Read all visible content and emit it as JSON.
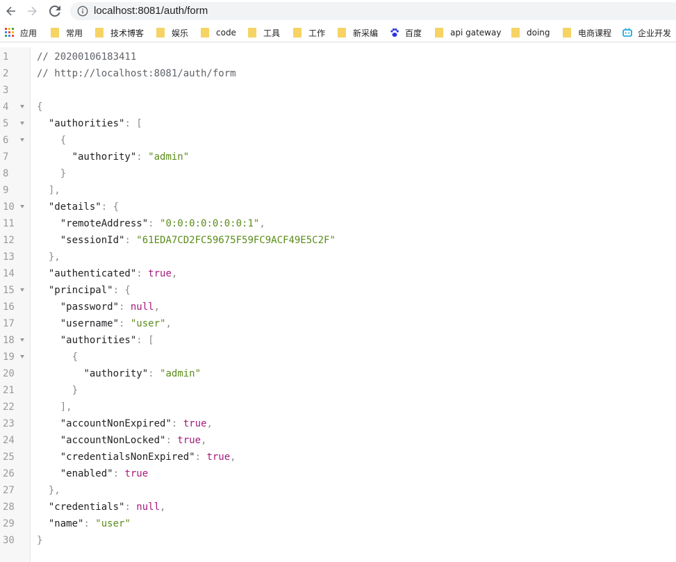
{
  "browser": {
    "url": "localhost:8081/auth/form"
  },
  "bookmarks": [
    {
      "label": "应用",
      "icon": "apps-grid-icon"
    },
    {
      "label": "常用",
      "icon": "folder-icon"
    },
    {
      "label": "技术博客",
      "icon": "folder-icon"
    },
    {
      "label": "娱乐",
      "icon": "folder-icon"
    },
    {
      "label": "code",
      "icon": "folder-icon"
    },
    {
      "label": "工具",
      "icon": "folder-icon"
    },
    {
      "label": "工作",
      "icon": "folder-icon"
    },
    {
      "label": "新采编",
      "icon": "folder-icon"
    },
    {
      "label": "百度",
      "icon": "baidu-paw-icon"
    },
    {
      "label": "api gateway",
      "icon": "folder-icon"
    },
    {
      "label": "doing",
      "icon": "folder-icon"
    },
    {
      "label": "电商课程",
      "icon": "folder-icon"
    },
    {
      "label": "企业开发",
      "icon": "bilibili-tv-icon"
    }
  ],
  "colors": {
    "string": "#5a8b19",
    "keyword": "#a5197c",
    "comment": "#5f6368",
    "folder": "#f6d365"
  },
  "lines": [
    {
      "n": "1",
      "fold": false,
      "tokens": [
        [
          "c",
          "// 20200106183411"
        ]
      ]
    },
    {
      "n": "2",
      "fold": false,
      "tokens": [
        [
          "c",
          "// http://localhost:8081/auth/form"
        ]
      ]
    },
    {
      "n": "3",
      "fold": false,
      "tokens": []
    },
    {
      "n": "4",
      "fold": true,
      "tokens": [
        [
          "p",
          "{"
        ]
      ]
    },
    {
      "n": "5",
      "fold": true,
      "tokens": [
        [
          "t",
          "  "
        ],
        [
          "k",
          "\"authorities\""
        ],
        [
          "p",
          ": ["
        ]
      ]
    },
    {
      "n": "6",
      "fold": true,
      "tokens": [
        [
          "t",
          "    "
        ],
        [
          "p",
          "{"
        ]
      ]
    },
    {
      "n": "7",
      "fold": false,
      "tokens": [
        [
          "t",
          "      "
        ],
        [
          "k",
          "\"authority\""
        ],
        [
          "p",
          ": "
        ],
        [
          "s",
          "\"admin\""
        ]
      ]
    },
    {
      "n": "8",
      "fold": false,
      "tokens": [
        [
          "t",
          "    "
        ],
        [
          "p",
          "}"
        ]
      ]
    },
    {
      "n": "9",
      "fold": false,
      "tokens": [
        [
          "t",
          "  "
        ],
        [
          "p",
          "],"
        ]
      ]
    },
    {
      "n": "10",
      "fold": true,
      "tokens": [
        [
          "t",
          "  "
        ],
        [
          "k",
          "\"details\""
        ],
        [
          "p",
          ": {"
        ]
      ]
    },
    {
      "n": "11",
      "fold": false,
      "tokens": [
        [
          "t",
          "    "
        ],
        [
          "k",
          "\"remoteAddress\""
        ],
        [
          "p",
          ": "
        ],
        [
          "s",
          "\"0:0:0:0:0:0:0:1\""
        ],
        [
          "p",
          ","
        ]
      ]
    },
    {
      "n": "12",
      "fold": false,
      "tokens": [
        [
          "t",
          "    "
        ],
        [
          "k",
          "\"sessionId\""
        ],
        [
          "p",
          ": "
        ],
        [
          "s",
          "\"61EDA7CD2FC59675F59FC9ACF49E5C2F\""
        ]
      ]
    },
    {
      "n": "13",
      "fold": false,
      "tokens": [
        [
          "t",
          "  "
        ],
        [
          "p",
          "},"
        ]
      ]
    },
    {
      "n": "14",
      "fold": false,
      "tokens": [
        [
          "t",
          "  "
        ],
        [
          "k",
          "\"authenticated\""
        ],
        [
          "p",
          ": "
        ],
        [
          "b",
          "true"
        ],
        [
          "p",
          ","
        ]
      ]
    },
    {
      "n": "15",
      "fold": true,
      "tokens": [
        [
          "t",
          "  "
        ],
        [
          "k",
          "\"principal\""
        ],
        [
          "p",
          ": {"
        ]
      ]
    },
    {
      "n": "16",
      "fold": false,
      "tokens": [
        [
          "t",
          "    "
        ],
        [
          "k",
          "\"password\""
        ],
        [
          "p",
          ": "
        ],
        [
          "b",
          "null"
        ],
        [
          "p",
          ","
        ]
      ]
    },
    {
      "n": "17",
      "fold": false,
      "tokens": [
        [
          "t",
          "    "
        ],
        [
          "k",
          "\"username\""
        ],
        [
          "p",
          ": "
        ],
        [
          "s",
          "\"user\""
        ],
        [
          "p",
          ","
        ]
      ]
    },
    {
      "n": "18",
      "fold": true,
      "tokens": [
        [
          "t",
          "    "
        ],
        [
          "k",
          "\"authorities\""
        ],
        [
          "p",
          ": ["
        ]
      ]
    },
    {
      "n": "19",
      "fold": true,
      "tokens": [
        [
          "t",
          "      "
        ],
        [
          "p",
          "{"
        ]
      ]
    },
    {
      "n": "20",
      "fold": false,
      "tokens": [
        [
          "t",
          "        "
        ],
        [
          "k",
          "\"authority\""
        ],
        [
          "p",
          ": "
        ],
        [
          "s",
          "\"admin\""
        ]
      ]
    },
    {
      "n": "21",
      "fold": false,
      "tokens": [
        [
          "t",
          "      "
        ],
        [
          "p",
          "}"
        ]
      ]
    },
    {
      "n": "22",
      "fold": false,
      "tokens": [
        [
          "t",
          "    "
        ],
        [
          "p",
          "],"
        ]
      ]
    },
    {
      "n": "23",
      "fold": false,
      "tokens": [
        [
          "t",
          "    "
        ],
        [
          "k",
          "\"accountNonExpired\""
        ],
        [
          "p",
          ": "
        ],
        [
          "b",
          "true"
        ],
        [
          "p",
          ","
        ]
      ]
    },
    {
      "n": "24",
      "fold": false,
      "tokens": [
        [
          "t",
          "    "
        ],
        [
          "k",
          "\"accountNonLocked\""
        ],
        [
          "p",
          ": "
        ],
        [
          "b",
          "true"
        ],
        [
          "p",
          ","
        ]
      ]
    },
    {
      "n": "25",
      "fold": false,
      "tokens": [
        [
          "t",
          "    "
        ],
        [
          "k",
          "\"credentialsNonExpired\""
        ],
        [
          "p",
          ": "
        ],
        [
          "b",
          "true"
        ],
        [
          "p",
          ","
        ]
      ]
    },
    {
      "n": "26",
      "fold": false,
      "tokens": [
        [
          "t",
          "    "
        ],
        [
          "k",
          "\"enabled\""
        ],
        [
          "p",
          ": "
        ],
        [
          "b",
          "true"
        ]
      ]
    },
    {
      "n": "27",
      "fold": false,
      "tokens": [
        [
          "t",
          "  "
        ],
        [
          "p",
          "},"
        ]
      ]
    },
    {
      "n": "28",
      "fold": false,
      "tokens": [
        [
          "t",
          "  "
        ],
        [
          "k",
          "\"credentials\""
        ],
        [
          "p",
          ": "
        ],
        [
          "b",
          "null"
        ],
        [
          "p",
          ","
        ]
      ]
    },
    {
      "n": "29",
      "fold": false,
      "tokens": [
        [
          "t",
          "  "
        ],
        [
          "k",
          "\"name\""
        ],
        [
          "p",
          ": "
        ],
        [
          "s",
          "\"user\""
        ]
      ]
    },
    {
      "n": "30",
      "fold": false,
      "tokens": [
        [
          "p",
          "}"
        ]
      ]
    }
  ]
}
